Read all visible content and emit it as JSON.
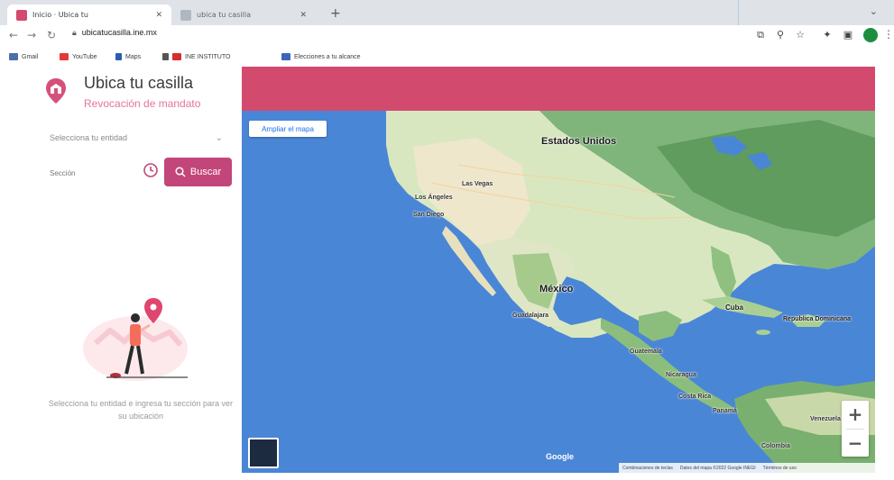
{
  "browser": {
    "tabs": [
      {
        "label": "Inicio · Ubica tu",
        "active": true
      },
      {
        "label": "ubica tu casilla",
        "active": false
      }
    ],
    "url": "ubicatucasilla.ine.mx",
    "bookmarks": [
      {
        "label": "Gmail"
      },
      {
        "label": "YouTube"
      },
      {
        "label": "Maps"
      },
      {
        "label": "INE INSTITUTO"
      },
      {
        "label": "Elecciones a tu alcance"
      }
    ],
    "colors": {
      "tabstrip": "#dfe3e8",
      "profile": "#1e8e3e"
    }
  },
  "app": {
    "title": "Ubica tu casilla",
    "subtitle": "Revocación de mandato",
    "select_placeholder": "Selecciona tu entidad",
    "search_placeholder": "Sección",
    "search_button": "Buscar",
    "hint": "Selecciona tu entidad e ingresa tu sección para ver su ubicación",
    "colors": {
      "accent": "#c2467a",
      "subtitle": "#e27596",
      "banner": "#d34a6f"
    }
  },
  "map": {
    "expand_button": "Ampliar el mapa",
    "labels": {
      "usa": "Estados Unidos",
      "mexico": "México",
      "cuba": "Cuba",
      "dominican": "República Dominicana",
      "guatemala": "Guatemala",
      "nicaragua": "Nicaragua",
      "costa_rica": "Costa Rica",
      "panama": "Panamá",
      "venezuela": "Venezuela",
      "colombia": "Colombia",
      "los_angeles": "Los Ángeles",
      "las_vegas": "Las Vegas",
      "san_diego": "San Diego",
      "guadalajara": "Guadalajara"
    },
    "zoom_in": "+",
    "zoom_out": "−",
    "google": "Google",
    "attribution": {
      "shortcuts": "Combinaciones de teclas",
      "data": "Datos del mapa ©2022 Google INEGI",
      "terms": "Términos de uso"
    }
  }
}
